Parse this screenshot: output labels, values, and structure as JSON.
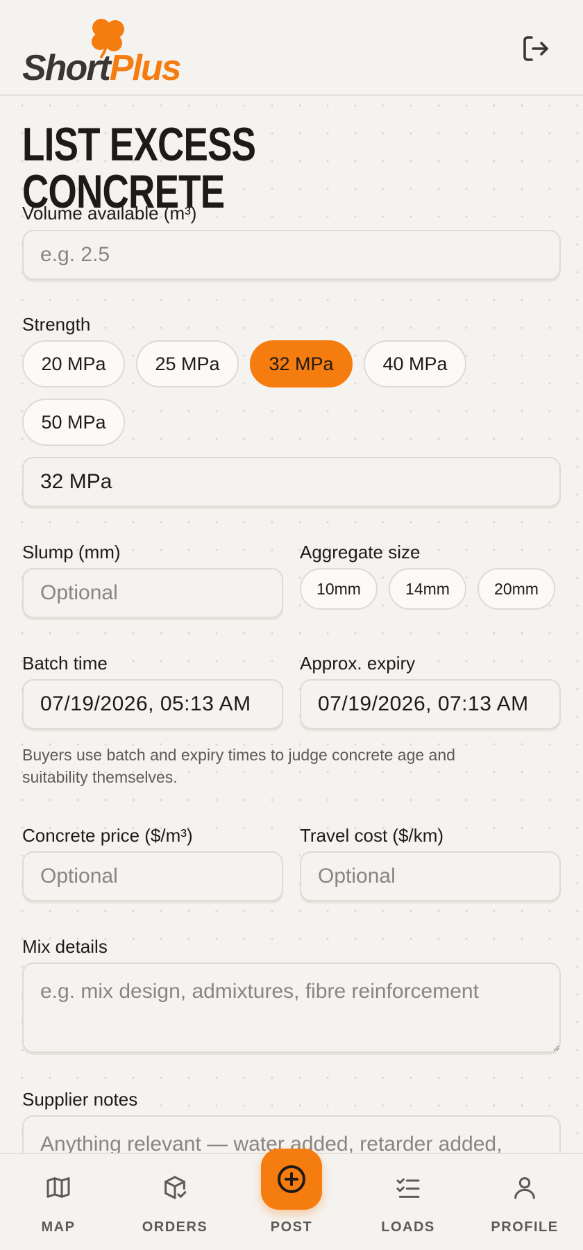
{
  "brand": {
    "short": "Short",
    "plus": "Plus",
    "accent": "#f57c0f"
  },
  "header": {
    "logout_icon": "logout-icon"
  },
  "page": {
    "title": "LIST EXCESS CONCRETE"
  },
  "form": {
    "volume": {
      "label": "Volume available (m³)",
      "placeholder": "e.g. 2.5",
      "value": ""
    },
    "strength": {
      "label": "Strength",
      "options": [
        "20 MPa",
        "25 MPa",
        "32 MPa",
        "40 MPa",
        "50 MPa"
      ],
      "selected": "32 MPa",
      "value": "32 MPa"
    },
    "slump": {
      "label": "Slump (mm)",
      "placeholder": "Optional",
      "value": ""
    },
    "aggregate": {
      "label": "Aggregate size",
      "options": [
        "10mm",
        "14mm",
        "20mm"
      ]
    },
    "batch_time": {
      "label": "Batch time",
      "value": "07/19/2026, 05:13 AM"
    },
    "expiry": {
      "label": "Approx. expiry",
      "value": "07/19/2026, 07:13 AM"
    },
    "time_hint": "Buyers use batch and expiry times to judge concrete age and suitability themselves.",
    "concrete_price": {
      "label": "Concrete price ($/m³)",
      "placeholder": "Optional",
      "value": ""
    },
    "travel_cost": {
      "label": "Travel cost ($/km)",
      "placeholder": "Optional",
      "value": ""
    },
    "mix_details": {
      "label": "Mix details",
      "placeholder": "e.g. mix design, admixtures, fibre reinforcement",
      "value": ""
    },
    "supplier_notes": {
      "label": "Supplier notes",
      "placeholder": "Anything relevant — water added, retarder added,",
      "value": ""
    }
  },
  "nav": {
    "items": [
      {
        "label": "MAP",
        "icon": "map-icon"
      },
      {
        "label": "ORDERS",
        "icon": "package-check-icon"
      },
      {
        "label": "POST",
        "icon": "plus-circle-icon"
      },
      {
        "label": "LOADS",
        "icon": "checklist-icon"
      },
      {
        "label": "PROFILE",
        "icon": "user-icon"
      }
    ]
  }
}
